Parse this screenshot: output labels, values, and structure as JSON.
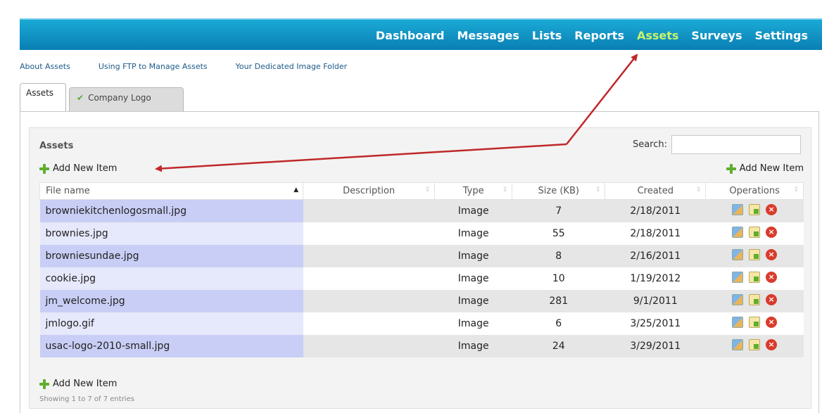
{
  "nav": {
    "items": [
      {
        "label": "Dashboard"
      },
      {
        "label": "Messages"
      },
      {
        "label": "Lists"
      },
      {
        "label": "Reports"
      },
      {
        "label": "Assets",
        "active": true
      },
      {
        "label": "Surveys"
      },
      {
        "label": "Settings"
      }
    ],
    "active_color": "#c8f56a"
  },
  "sublinks": [
    "About Assets",
    "Using FTP to Manage Assets",
    "Your Dedicated Image Folder"
  ],
  "tabs": {
    "assets": "Assets",
    "company_logo": "Company Logo"
  },
  "panel": {
    "title": "Assets",
    "search_label": "Search:",
    "search_value": "",
    "add_new_label": "Add New Item",
    "footer_info": "Showing 1 to 7 of 7 entries"
  },
  "table": {
    "columns": [
      "File name",
      "Description",
      "Type",
      "Size (KB)",
      "Created",
      "Operations"
    ],
    "sorted_column": "File name",
    "rows": [
      {
        "file": "browniekitchenlogosmall.jpg",
        "description": "",
        "type": "Image",
        "size": "7",
        "created": "2/18/2011"
      },
      {
        "file": "brownies.jpg",
        "description": "",
        "type": "Image",
        "size": "55",
        "created": "2/18/2011"
      },
      {
        "file": "browniesundae.jpg",
        "description": "",
        "type": "Image",
        "size": "8",
        "created": "2/16/2011"
      },
      {
        "file": "cookie.jpg",
        "description": "",
        "type": "Image",
        "size": "10",
        "created": "1/19/2012"
      },
      {
        "file": "jm_welcome.jpg",
        "description": "",
        "type": "Image",
        "size": "281",
        "created": "9/1/2011"
      },
      {
        "file": "jmlogo.gif",
        "description": "",
        "type": "Image",
        "size": "6",
        "created": "3/25/2011"
      },
      {
        "file": "usac-logo-2010-small.jpg",
        "description": "",
        "type": "Image",
        "size": "24",
        "created": "3/29/2011"
      }
    ],
    "row_icons": [
      "copy-icon",
      "edit-icon",
      "delete-icon"
    ]
  },
  "colors": {
    "nav_bar": "#0a7fb3",
    "annotation_arrow": "#c0282a"
  }
}
